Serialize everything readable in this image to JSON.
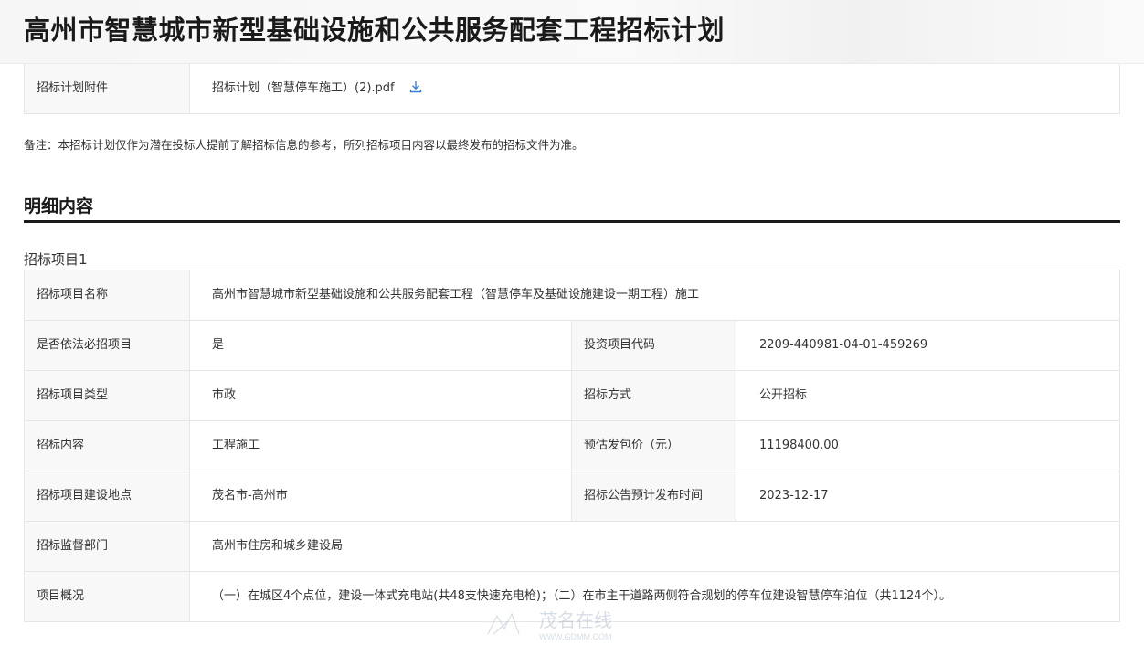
{
  "header": {
    "title": "高州市智慧城市新型基础设施和公共服务配套工程招标计划"
  },
  "attachment": {
    "label": "招标计划附件",
    "file_name": "招标计划（智慧停车施工）(2).pdf",
    "icon": "download-icon"
  },
  "note": "备注：本招标计划仅作为潜在投标人提前了解招标信息的参考，所列招标项目内容以最终发布的招标文件为准。",
  "detail": {
    "section_title": "明细内容",
    "item_heading": "招标项目1",
    "rows": {
      "project_name": {
        "label": "招标项目名称",
        "value": "高州市智慧城市新型基础设施和公共服务配套工程（智慧停车及基础设施建设一期工程）施工"
      },
      "mandatory": {
        "label": "是否依法必招项目",
        "value": "是"
      },
      "invest_code": {
        "label": "投资项目代码",
        "value": "2209-440981-04-01-459269"
      },
      "project_type": {
        "label": "招标项目类型",
        "value": "市政"
      },
      "bid_method": {
        "label": "招标方式",
        "value": "公开招标"
      },
      "content": {
        "label": "招标内容",
        "value": "工程施工"
      },
      "est_price": {
        "label": "预估发包价（元）",
        "value": "11198400.00"
      },
      "location": {
        "label": "招标项目建设地点",
        "value": "茂名市-高州市"
      },
      "announce_date": {
        "label": "招标公告预计发布时间",
        "value": "2023-12-17"
      },
      "supervisor": {
        "label": "招标监督部门",
        "value": "高州市住房和城乡建设局"
      },
      "overview": {
        "label": "项目概况",
        "value": "（一）在城区4个点位，建设一体式充电站(共48支快速充电枪)；（二）在市主干道路两侧符合规划的停车位建设智慧停车泊位（共1124个）。"
      }
    }
  },
  "watermark": {
    "brand": "茂名在线",
    "url": "WWW.GDMM.COM"
  },
  "colors": {
    "label_bg": "#f8f8f8",
    "border": "#e6e6e6",
    "link_blue": "#3b7ddd",
    "rule": "#1a1a1a"
  }
}
